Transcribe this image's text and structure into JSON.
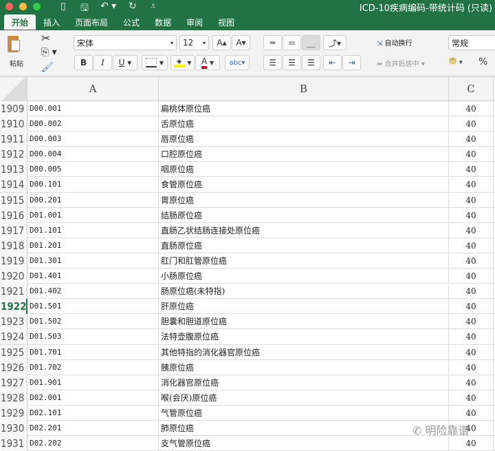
{
  "window": {
    "title": "ICD-10疾病编码-带统计码 (只读)"
  },
  "quick_access": {
    "sidebar": "▯",
    "save": "🖫",
    "undo": "↶ ▾",
    "redo": "↻",
    "more": "⩡"
  },
  "tabs": [
    {
      "label": "开始",
      "active": true
    },
    {
      "label": "插入"
    },
    {
      "label": "页面布局"
    },
    {
      "label": "公式"
    },
    {
      "label": "数据"
    },
    {
      "label": "审阅"
    },
    {
      "label": "视图"
    }
  ],
  "ribbon": {
    "paste_label": "粘贴",
    "font_name": "宋体",
    "font_size": "12",
    "grow": "A▴",
    "shrink": "A▾",
    "bold": "B",
    "italic": "I",
    "underline": "U",
    "wrap_text": "自动换行",
    "merge_center": "合并后居中",
    "number_format": "常规",
    "percent": "%",
    "font_color": "#d0021b",
    "fill_color": "#fff200"
  },
  "columns": [
    "A",
    "B",
    "C"
  ],
  "selected_row": "1922",
  "rows": [
    [
      "1909",
      "D00.001",
      "扁桃体原位癌",
      "40"
    ],
    [
      "1910",
      "D00.002",
      "舌原位癌",
      "40"
    ],
    [
      "1911",
      "D00.003",
      "唇原位癌",
      "40"
    ],
    [
      "1912",
      "D00.004",
      "口腔原位癌",
      "40"
    ],
    [
      "1913",
      "D00.005",
      "咽原位癌",
      "40"
    ],
    [
      "1914",
      "D00.101",
      "食管原位癌",
      "40"
    ],
    [
      "1915",
      "D00.201",
      "胃原位癌",
      "40"
    ],
    [
      "1916",
      "D01.001",
      "结肠原位癌",
      "40"
    ],
    [
      "1917",
      "D01.101",
      "直肠乙状结肠连接处原位癌",
      "40"
    ],
    [
      "1918",
      "D01.201",
      "直肠原位癌",
      "40"
    ],
    [
      "1919",
      "D01.301",
      "肛门和肛管原位癌",
      "40"
    ],
    [
      "1920",
      "D01.401",
      "小肠原位癌",
      "40"
    ],
    [
      "1921",
      "D01.402",
      "肠原位癌(未特指)",
      "40"
    ],
    [
      "1922",
      "D01.501",
      "肝原位癌",
      "40"
    ],
    [
      "1923",
      "D01.502",
      "胆囊和胆道原位癌",
      "40"
    ],
    [
      "1924",
      "D01.503",
      "法特壶腹原位癌",
      "40"
    ],
    [
      "1925",
      "D01.701",
      "其他特指的消化器官原位癌",
      "40"
    ],
    [
      "1926",
      "D01.702",
      "胰原位癌",
      "40"
    ],
    [
      "1927",
      "D01.901",
      "消化器官原位癌",
      "40"
    ],
    [
      "1928",
      "D02.001",
      "喉(会厌)原位癌",
      "40"
    ],
    [
      "1929",
      "D02.101",
      "气管原位癌",
      "40"
    ],
    [
      "1930",
      "D02.201",
      "肺原位癌",
      "40"
    ],
    [
      "1931",
      "D02.202",
      "支气管原位癌",
      "40"
    ]
  ],
  "watermark": "明险靠谱",
  "colors": {
    "accent": "#217346"
  }
}
